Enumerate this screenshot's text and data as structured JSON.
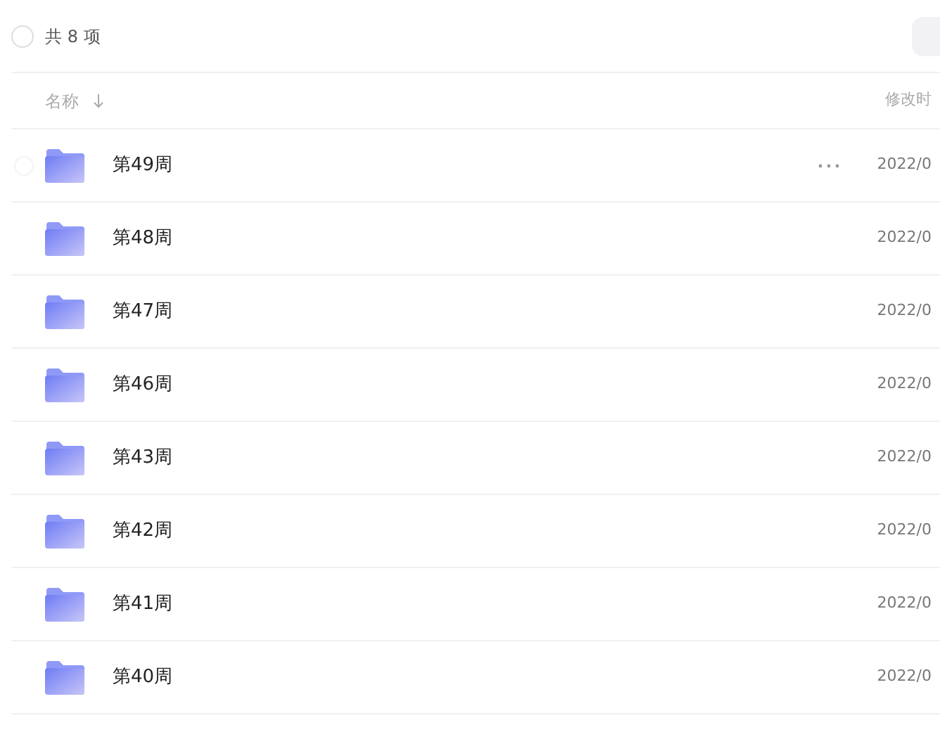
{
  "toolbar": {
    "checked": false,
    "count": "共 8 项"
  },
  "columns": [
    "名称",
    "修改时"
  ],
  "rows": [
    {
      "name": "第49周",
      "modified": "2022/0",
      "hovered": true,
      "checked": false
    },
    {
      "name": "第48周",
      "modified": "2022/0",
      "hovered": false
    },
    {
      "name": "第47周",
      "modified": "2022/0",
      "hovered": false
    },
    {
      "name": "第46周",
      "modified": "2022/0",
      "hovered": false
    },
    {
      "name": "第43周",
      "modified": "2022/0",
      "hovered": false
    },
    {
      "name": "第42周",
      "modified": "2022/0",
      "hovered": false
    },
    {
      "name": "第41周",
      "modified": "2022/0",
      "hovered": false
    },
    {
      "name": "第40周",
      "modified": "2022/0",
      "hovered": false
    }
  ]
}
